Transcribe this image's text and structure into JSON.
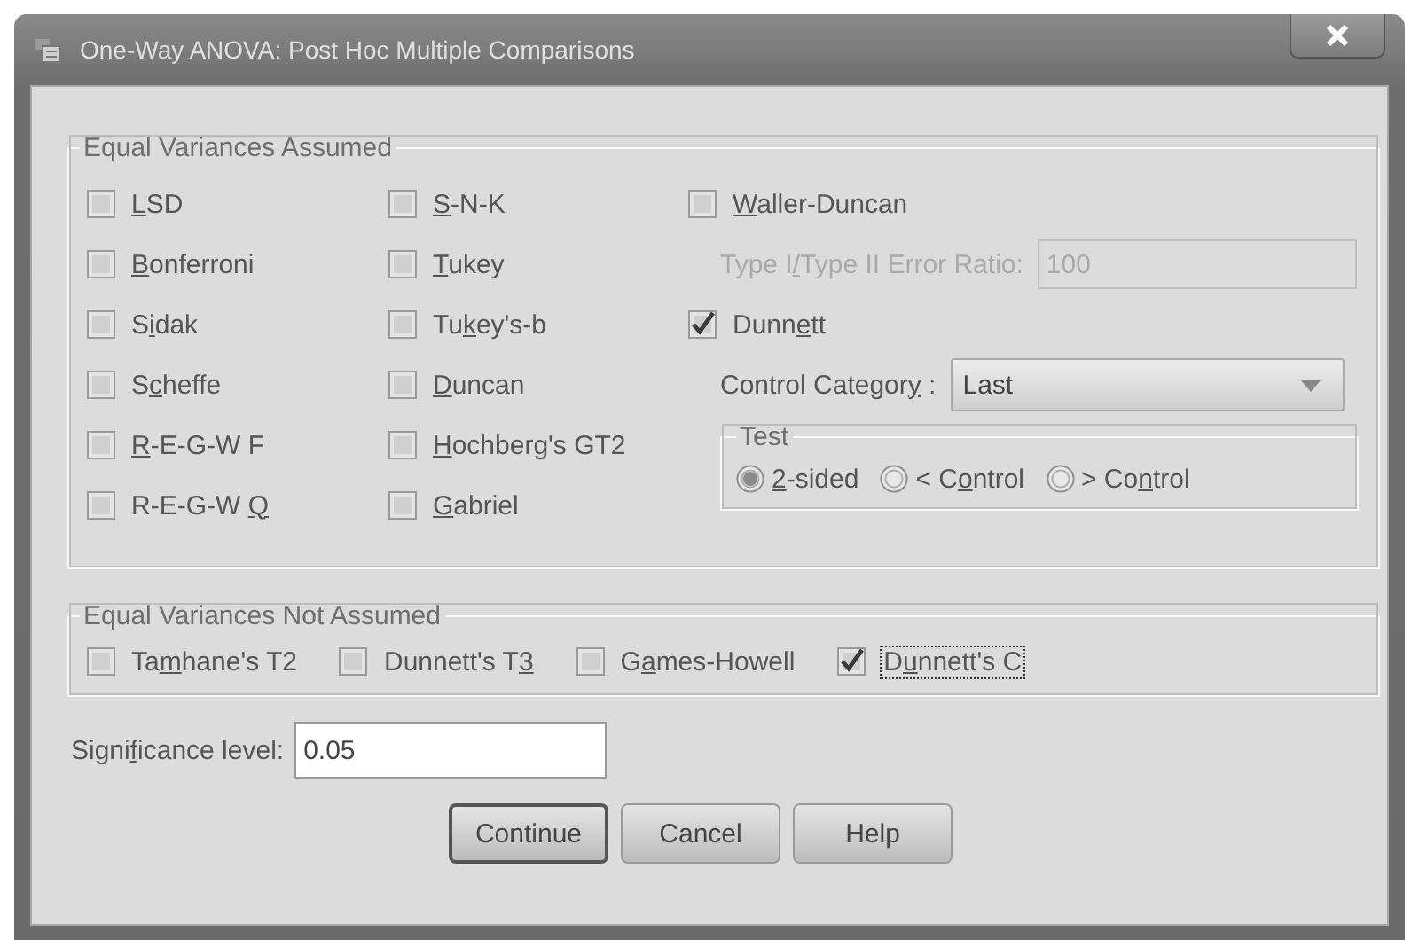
{
  "window": {
    "title": "One-Way ANOVA: Post Hoc Multiple Comparisons"
  },
  "equal_variances_assumed": {
    "title": "Equal Variances Assumed",
    "columns": [
      [
        {
          "kind": "checkbox",
          "label": {
            "key": "L",
            "after": "SD"
          },
          "checked": false
        },
        {
          "kind": "checkbox",
          "label": {
            "key": "B",
            "after": "onferroni"
          },
          "checked": false
        },
        {
          "kind": "checkbox",
          "label": {
            "before": "S",
            "key": "i",
            "after": "dak"
          },
          "checked": false
        },
        {
          "kind": "checkbox",
          "label": {
            "before": "S",
            "key": "c",
            "after": "heffe"
          },
          "checked": false
        },
        {
          "kind": "checkbox",
          "label": {
            "key": "R",
            "after": "-E-G-W F"
          },
          "checked": false
        },
        {
          "kind": "checkbox",
          "label": {
            "before": "R-E-G-W ",
            "key": "Q"
          },
          "checked": false
        }
      ],
      [
        {
          "kind": "checkbox",
          "label": {
            "key": "S",
            "after": "-N-K"
          },
          "checked": false
        },
        {
          "kind": "checkbox",
          "label": {
            "key": "T",
            "after": "ukey"
          },
          "checked": false
        },
        {
          "kind": "checkbox",
          "label": {
            "before": "Tu",
            "key": "k",
            "after": "ey's-b"
          },
          "checked": false
        },
        {
          "kind": "checkbox",
          "label": {
            "key": "D",
            "after": "uncan"
          },
          "checked": false
        },
        {
          "kind": "checkbox",
          "label": {
            "key": "H",
            "after": "ochberg's GT2"
          },
          "checked": false
        },
        {
          "kind": "checkbox",
          "label": {
            "key": "G",
            "after": "abriel"
          },
          "checked": false
        }
      ],
      [
        {
          "kind": "checkbox",
          "label": {
            "key": "W",
            "after": "aller-Duncan"
          },
          "checked": false
        },
        {
          "kind": "field",
          "label": {
            "before": "Type I",
            "key": "/",
            "after": "Type II Error Ratio:"
          },
          "value": "100",
          "disabled": true
        },
        {
          "kind": "checkbox",
          "label": {
            "before": "Dunn",
            "key": "e",
            "after": "tt"
          },
          "checked": true
        },
        {
          "kind": "dropdown",
          "label": {
            "before": "Control Categor",
            "key": "y",
            "after": " :"
          },
          "value": "Last"
        },
        {
          "kind": "radio_group",
          "title": "Test",
          "options": [
            {
              "label": {
                "key": "2",
                "after": "-sided"
              },
              "selected": true
            },
            {
              "label": {
                "before": "< C",
                "key": "o",
                "after": "ntrol"
              },
              "selected": false
            },
            {
              "label": {
                "before": "> Co",
                "key": "n",
                "after": "trol"
              },
              "selected": false
            }
          ]
        }
      ]
    ]
  },
  "equal_variances_not_assumed": {
    "title": "Equal Variances Not Assumed",
    "items": [
      {
        "label": {
          "before": "Ta",
          "key": "m",
          "after": "hane's T2"
        },
        "checked": false,
        "focused": false
      },
      {
        "label": {
          "before": "Dunnett's T",
          "key": "3"
        },
        "checked": false,
        "focused": false
      },
      {
        "label": {
          "before": "G",
          "key": "a",
          "after": "mes-Howell"
        },
        "checked": false,
        "focused": false
      },
      {
        "label": {
          "before": "D",
          "key": "u",
          "after": "nnett's C"
        },
        "checked": true,
        "focused": true
      }
    ]
  },
  "significance": {
    "label": {
      "before": "Signi",
      "key": "f",
      "after": "icance level:"
    },
    "value": "0.05"
  },
  "buttons": [
    {
      "label": "Continue",
      "default": true
    },
    {
      "label": "Cancel",
      "default": false
    },
    {
      "label": "Help",
      "default": false
    }
  ]
}
